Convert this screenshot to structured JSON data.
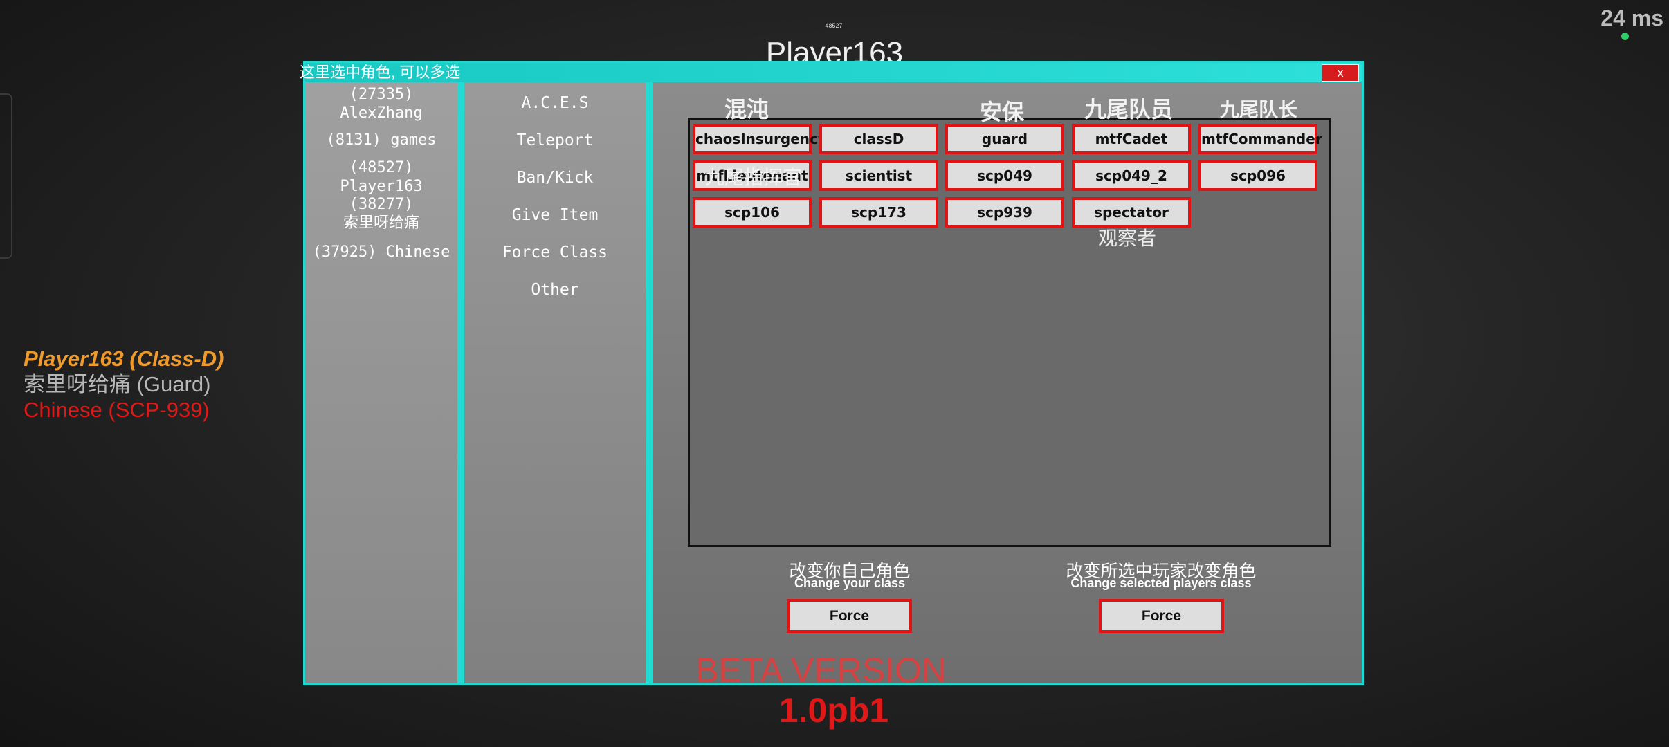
{
  "hud": {
    "id_small": "48527",
    "player_name": "Player163",
    "ping": "24 ms"
  },
  "player_list": [
    {
      "text": "Player163 (Class-D)",
      "color": "#f19a2c"
    },
    {
      "text": "索里呀给痛 (Guard)",
      "color": "#b8b8b8"
    },
    {
      "text": "Chinese (SCP-939)",
      "color": "#e01818"
    }
  ],
  "window": {
    "title": "这里选中角色, 可以多选",
    "close_label": "x",
    "players": [
      {
        "id": "(27335)",
        "name": "AlexZhang"
      },
      {
        "line": "(8131) games"
      },
      {
        "id": "(48527)",
        "name": "Player163"
      },
      {
        "id": "(38277)",
        "name": "索里呀给痛"
      },
      {
        "line": "(37925) Chinese"
      }
    ],
    "menu": [
      "A.C.E.S",
      "Teleport",
      "Ban/Kick",
      "Give Item",
      "Force Class",
      "Other"
    ],
    "class_labels_cn": {
      "chaos": "混沌",
      "guard": "安保",
      "mtf_cadet": "九尾队员",
      "mtf_commander": "九尾队长",
      "mtf_lieutenant": "九尾指挥官",
      "spectator": "观察者"
    },
    "classes": [
      [
        "chaosInsurgency",
        "classD",
        "guard",
        "mtfCadet",
        "mtfCommander"
      ],
      [
        "mtfLieutenant",
        "scientist",
        "scp049",
        "scp049_2",
        "scp096"
      ],
      [
        "scp106",
        "scp173",
        "scp939",
        "spectator"
      ]
    ],
    "actions": {
      "self_cn": "改变你自己角色",
      "self_en": "Change your class",
      "self_button": "Force",
      "selected_cn": "改变所选中玩家改变角色",
      "selected_en": "Change selected players class",
      "selected_button": "Force"
    }
  },
  "footer": {
    "beta": "BETA VERSION",
    "version": "1.0pb1"
  },
  "colors": {
    "accent_cyan": "#1fd8d0",
    "button_border_red": "#e01414",
    "ping_dot": "#2fd06a"
  }
}
